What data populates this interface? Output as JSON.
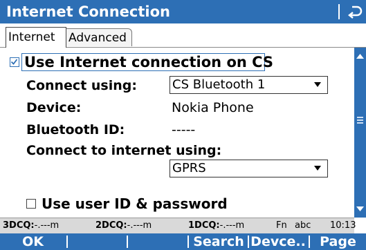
{
  "window": {
    "title": "Internet Connection"
  },
  "tabs": [
    {
      "label": "Internet"
    },
    {
      "label": "Advanced"
    }
  ],
  "form": {
    "use_internet": {
      "label": "Use Internet connection on CS",
      "checked": true
    },
    "connect_using": {
      "label": "Connect using:",
      "value": "CS Bluetooth 1"
    },
    "device": {
      "label": "Device:",
      "value": "Nokia Phone"
    },
    "bluetooth_id": {
      "label": "Bluetooth ID:",
      "value": "-----"
    },
    "connect_internet_using": {
      "label": "Connect to internet using:",
      "value": "GPRS"
    },
    "use_user_id": {
      "label": "Use user ID & password",
      "checked": false
    }
  },
  "statusbar": {
    "dcq3_label": "3DCQ:",
    "dcq3_value": "-.---m",
    "dcq2_label": "2DCQ:",
    "dcq2_value": "-.---m",
    "dcq1_label": "1DCQ:",
    "dcq1_value": "-.---m",
    "fn": "Fn",
    "input_mode": "abc",
    "time": "10:13"
  },
  "softkeys": {
    "ok": "OK",
    "search": "Search",
    "device": "Devce..",
    "page": "Page"
  },
  "colors": {
    "accent": "#2d6fb5",
    "statusbar_bg": "#d9d9d9"
  }
}
